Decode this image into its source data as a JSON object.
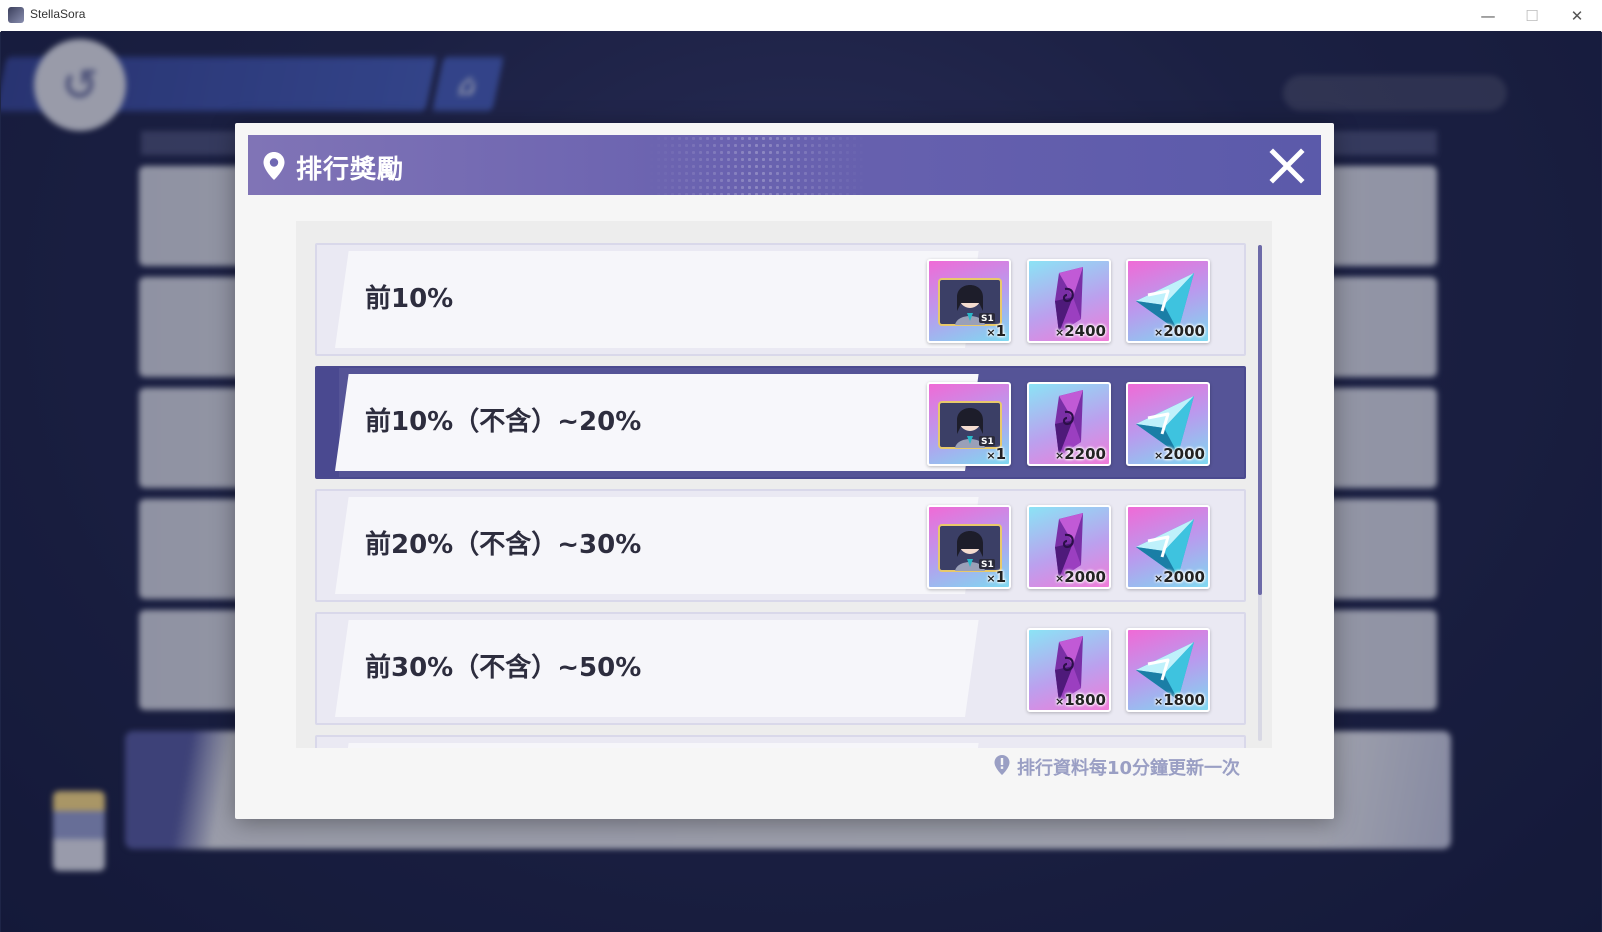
{
  "window": {
    "title": "StellaSora",
    "minimize": "—",
    "maximize": "☐",
    "close": "✕"
  },
  "background": {
    "home_icon": "home-icon",
    "back_icon": "back-arrow-icon"
  },
  "modal": {
    "title": "排行獎勵",
    "title_icon": "location-pin-icon",
    "close_icon": "close-icon",
    "note": "排行資料每10分鐘更新一次",
    "note_icon": "info-exclamation-icon",
    "colors": {
      "header": "#6b63b0",
      "selected_row": "#555497",
      "note_text": "#9a9fc4"
    }
  },
  "rows": [
    {
      "label": "前10%",
      "selected": false,
      "rewards": [
        {
          "icon": "character-portrait-s1",
          "quantity": "1"
        },
        {
          "icon": "purple-crystal-icon",
          "quantity": "2400"
        },
        {
          "icon": "cyan-diamond-icon",
          "quantity": "2000"
        }
      ]
    },
    {
      "label": "前10%（不含）~20%",
      "selected": true,
      "rewards": [
        {
          "icon": "character-portrait-s1",
          "quantity": "1"
        },
        {
          "icon": "purple-crystal-icon",
          "quantity": "2200"
        },
        {
          "icon": "cyan-diamond-icon",
          "quantity": "2000"
        }
      ]
    },
    {
      "label": "前20%（不含）~30%",
      "selected": false,
      "rewards": [
        {
          "icon": "character-portrait-s1",
          "quantity": "1"
        },
        {
          "icon": "purple-crystal-icon",
          "quantity": "2000"
        },
        {
          "icon": "cyan-diamond-icon",
          "quantity": "2000"
        }
      ]
    },
    {
      "label": "前30%（不含）~50%",
      "selected": false,
      "rewards": [
        {
          "icon": "purple-crystal-icon",
          "quantity": "1800"
        },
        {
          "icon": "cyan-diamond-icon",
          "quantity": "1800"
        }
      ]
    }
  ],
  "quantity_prefix": "×"
}
